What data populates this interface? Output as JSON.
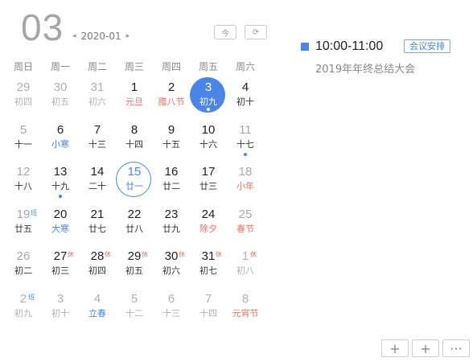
{
  "header": {
    "day": "03",
    "month": "2020-01",
    "prev_icon": "◂",
    "next_icon": "▸",
    "today_label": "今",
    "refresh_icon": "⟳"
  },
  "weekdays": [
    "周日",
    "周一",
    "周二",
    "周三",
    "周四",
    "周五",
    "周六"
  ],
  "rows": [
    [
      {
        "n": "29",
        "l": "初四",
        "dim": true
      },
      {
        "n": "30",
        "l": "初五",
        "dim": true
      },
      {
        "n": "31",
        "l": "初六",
        "dim": true
      },
      {
        "n": "1",
        "l": "元旦",
        "lc": "red"
      },
      {
        "n": "2",
        "l": "腊八节",
        "lc": "red"
      },
      {
        "n": "3",
        "l": "初九",
        "sel": true,
        "dot": true
      },
      {
        "n": "4",
        "l": "初十"
      }
    ],
    [
      {
        "n": "5",
        "l": "十一",
        "dimnum": true
      },
      {
        "n": "6",
        "l": "小寒",
        "lc": "blue"
      },
      {
        "n": "7",
        "l": "十三"
      },
      {
        "n": "8",
        "l": "十四"
      },
      {
        "n": "9",
        "l": "十五"
      },
      {
        "n": "10",
        "l": "十六"
      },
      {
        "n": "11",
        "l": "十七",
        "dimnum": true,
        "dot": true
      }
    ],
    [
      {
        "n": "12",
        "l": "十八",
        "dimnum": true
      },
      {
        "n": "13",
        "l": "十九",
        "dot": true
      },
      {
        "n": "14",
        "l": "二十"
      },
      {
        "n": "15",
        "l": "廿一",
        "today": true
      },
      {
        "n": "16",
        "l": "廿二"
      },
      {
        "n": "17",
        "l": "廿三"
      },
      {
        "n": "18",
        "l": "小年",
        "lc": "red",
        "dimnum": true
      }
    ],
    [
      {
        "n": "19",
        "l": "廿五",
        "dimnum": true,
        "badge": "班",
        "bt": "work"
      },
      {
        "n": "20",
        "l": "大寒",
        "lc": "blue"
      },
      {
        "n": "21",
        "l": "廿七"
      },
      {
        "n": "22",
        "l": "廿八"
      },
      {
        "n": "23",
        "l": "廿九"
      },
      {
        "n": "24",
        "l": "除夕",
        "lc": "red"
      },
      {
        "n": "25",
        "l": "春节",
        "lc": "red",
        "dimnum": true
      }
    ],
    [
      {
        "n": "26",
        "l": "初二",
        "dimnum": true
      },
      {
        "n": "27",
        "l": "初三",
        "badge": "休",
        "bt": "rest"
      },
      {
        "n": "28",
        "l": "初四",
        "badge": "休",
        "bt": "rest"
      },
      {
        "n": "29",
        "l": "初五",
        "badge": "休",
        "bt": "rest"
      },
      {
        "n": "30",
        "l": "初六",
        "badge": "休",
        "bt": "rest"
      },
      {
        "n": "31",
        "l": "初七",
        "badge": "休",
        "bt": "rest"
      },
      {
        "n": "1",
        "l": "初八",
        "dim": true,
        "badge": "休",
        "bt": "rest"
      }
    ],
    [
      {
        "n": "2",
        "l": "初九",
        "dim": true,
        "badge": "班",
        "bt": "work"
      },
      {
        "n": "3",
        "l": "初十",
        "dim": true
      },
      {
        "n": "4",
        "l": "立春",
        "dim": true,
        "lc": "blue"
      },
      {
        "n": "5",
        "l": "十二",
        "dim": true
      },
      {
        "n": "6",
        "l": "十三",
        "dim": true
      },
      {
        "n": "7",
        "l": "十四",
        "dim": true
      },
      {
        "n": "8",
        "l": "元宵节",
        "dim": true,
        "lc": "red"
      }
    ]
  ],
  "event": {
    "time": "10:00-11:00",
    "tag": "会议安排",
    "title": "2019年年终总结大会"
  },
  "footer": {
    "add1": "+",
    "add2": "+",
    "more": "···"
  }
}
